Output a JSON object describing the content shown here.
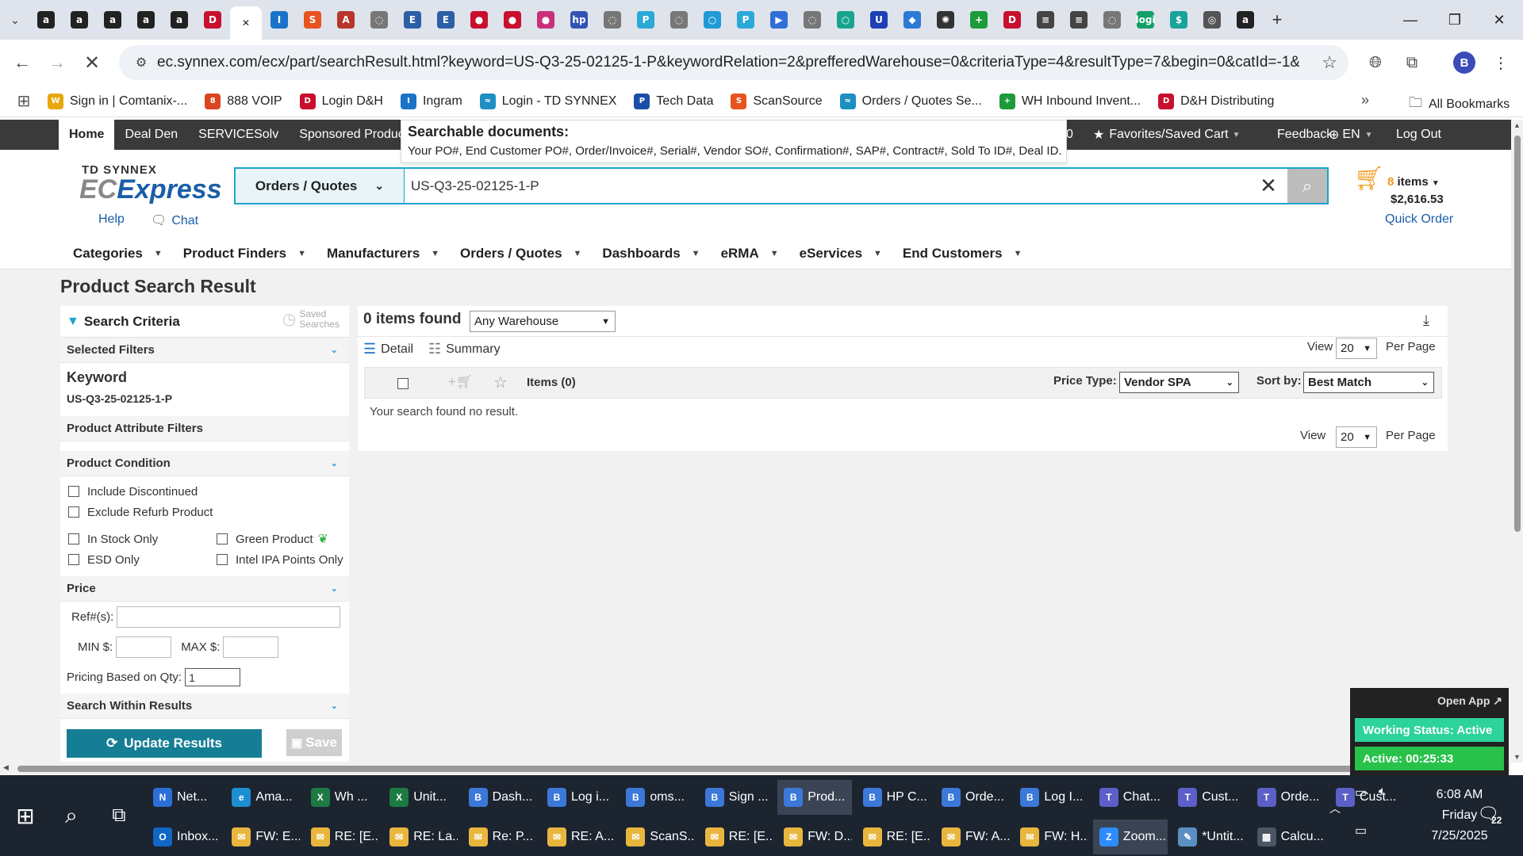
{
  "browser": {
    "tabs": [
      {
        "icon": "amazon-icon",
        "glyph": "a",
        "color": "#222222"
      },
      {
        "icon": "amazon-icon",
        "glyph": "a",
        "color": "#222222"
      },
      {
        "icon": "amazon-icon",
        "glyph": "a",
        "color": "#222222"
      },
      {
        "icon": "amazon-icon",
        "glyph": "a",
        "color": "#222222"
      },
      {
        "icon": "amazon-icon",
        "glyph": "a",
        "color": "#222222"
      },
      {
        "icon": "dh-icon",
        "glyph": "D",
        "color": "#c8102e"
      },
      {
        "icon": "td-synnex-icon",
        "glyph": "✕",
        "color": "#ffffff",
        "active": true
      },
      {
        "icon": "ingram-icon",
        "glyph": "I",
        "color": "#1a73c9"
      },
      {
        "icon": "scansource-icon",
        "glyph": "S",
        "color": "#e8541e"
      },
      {
        "icon": "site-icon",
        "glyph": "A",
        "color": "#b7352a"
      },
      {
        "icon": "globe-icon",
        "glyph": "◌",
        "color": "#777777"
      },
      {
        "icon": "site-icon",
        "glyph": "E",
        "color": "#2b5fa6"
      },
      {
        "icon": "site-icon",
        "glyph": "E",
        "color": "#2b5fa6"
      },
      {
        "icon": "site-icon",
        "glyph": "●",
        "color": "#c8102e"
      },
      {
        "icon": "site-icon",
        "glyph": "●",
        "color": "#c8102e"
      },
      {
        "icon": "site-icon",
        "glyph": "●",
        "color": "#c8317a"
      },
      {
        "icon": "hp-icon",
        "glyph": "hp",
        "color": "#3153b6"
      },
      {
        "icon": "globe-icon",
        "glyph": "◌",
        "color": "#777777"
      },
      {
        "icon": "site-icon",
        "glyph": "P",
        "color": "#2aa9d8"
      },
      {
        "icon": "globe-icon",
        "glyph": "◌",
        "color": "#777777"
      },
      {
        "icon": "site-icon",
        "glyph": "○",
        "color": "#1f9ad6"
      },
      {
        "icon": "site-icon",
        "glyph": "P",
        "color": "#2aa9d8"
      },
      {
        "icon": "site-icon",
        "glyph": "▶",
        "color": "#2f6fd6"
      },
      {
        "icon": "globe-icon",
        "glyph": "◌",
        "color": "#777777"
      },
      {
        "icon": "site-icon",
        "glyph": "○",
        "color": "#15a58d"
      },
      {
        "icon": "site-icon",
        "glyph": "U",
        "color": "#1f3fb5"
      },
      {
        "icon": "site-icon",
        "glyph": "◆",
        "color": "#2c7ad6"
      },
      {
        "icon": "openai-icon",
        "glyph": "✺",
        "color": "#333333"
      },
      {
        "icon": "site-icon",
        "glyph": "+",
        "color": "#1d9a3b"
      },
      {
        "icon": "dh-icon",
        "glyph": "D",
        "color": "#c8102e"
      },
      {
        "icon": "site-icon",
        "glyph": "≡",
        "color": "#444444"
      },
      {
        "icon": "site-icon",
        "glyph": "≡",
        "color": "#444444"
      },
      {
        "icon": "globe-icon",
        "glyph": "◌",
        "color": "#777777"
      },
      {
        "icon": "logi-icon",
        "glyph": "logi",
        "color": "#13a06a"
      },
      {
        "icon": "site-icon",
        "glyph": "$",
        "color": "#1aa39a"
      },
      {
        "icon": "site-icon",
        "glyph": "◎",
        "color": "#555555"
      },
      {
        "icon": "amazon-icon",
        "glyph": "a",
        "color": "#222222"
      }
    ],
    "url": "ec.synnex.com/ecx/part/searchResult.html?keyword=US-Q3-25-02125-1-P&keywordRelation=2&prefferedWarehouse=0&criteriaType=4&resultType=7&begin=0&catId=-1&suggestionS...",
    "profile_initial": "B",
    "bookmarks": [
      {
        "label": "Sign in | Comtanix-...",
        "icon": "comtanix-icon",
        "glyph": "W",
        "color": "#e8a80c"
      },
      {
        "label": "888 VOIP",
        "icon": "voip-icon",
        "glyph": "8",
        "color": "#d9461f"
      },
      {
        "label": "Login D&H",
        "icon": "dh-icon",
        "glyph": "D",
        "color": "#c8102e"
      },
      {
        "label": "Ingram",
        "icon": "ingram-icon",
        "glyph": "I",
        "color": "#1a73c9"
      },
      {
        "label": "Login - TD SYNNEX",
        "icon": "td-synnex-icon",
        "glyph": "≈",
        "color": "#1d8fc2"
      },
      {
        "label": "Tech Data",
        "icon": "tech-data-icon",
        "glyph": "P",
        "color": "#1a4fa8"
      },
      {
        "label": "ScanSource",
        "icon": "scansource-icon",
        "glyph": "S",
        "color": "#e8541e"
      },
      {
        "label": "Orders / Quotes Se...",
        "icon": "td-synnex-icon",
        "glyph": "≈",
        "color": "#1d8fc2"
      },
      {
        "label": "WH Inbound Invent...",
        "icon": "sheets-icon",
        "glyph": "+",
        "color": "#1d9a3b"
      },
      {
        "label": "D&H Distributing",
        "icon": "dh-icon",
        "glyph": "D",
        "color": "#c8102e"
      }
    ],
    "all_bookmarks": "All Bookmarks"
  },
  "sitebar": {
    "items": [
      "Home",
      "Deal Den",
      "SERVICESolv",
      "Sponsored Products"
    ],
    "hidden_fragment": "0",
    "favorites": "Favorites/Saved Cart",
    "feedback": "Feedback",
    "language": "EN",
    "logout": "Log Out"
  },
  "tooltip": {
    "title": "Searchable documents:",
    "body": "Your PO#, End Customer PO#, Order/Invoice#, Serial#, Vendor SO#, Confirmation#, SAP#, Contract#, Sold To ID#, Deal ID."
  },
  "header": {
    "brand_top": "TD SYNNEX",
    "brand_ec": "EC",
    "brand_express": "Express",
    "help": "Help",
    "chat": "Chat",
    "search_category": "Orders / Quotes",
    "search_value": "US-Q3-25-02125-1-P",
    "cart_count": "8",
    "cart_items_label": "items",
    "cart_total": "$2,616.53",
    "quick_order": "Quick Order"
  },
  "mainmenu": [
    "Categories",
    "Product Finders",
    "Manufacturers",
    "Orders / Quotes",
    "Dashboards",
    "eRMA",
    "eServices",
    "End Customers"
  ],
  "page": {
    "title": "Product Search Result"
  },
  "sidebar": {
    "title": "Search Criteria",
    "saved_searches_1": "Saved",
    "saved_searches_2": "Searches",
    "selected_filters": "Selected Filters",
    "keyword_label": "Keyword",
    "keyword_value": "US-Q3-25-02125-1-P",
    "attribute_filters": "Product Attribute Filters",
    "product_condition": "Product Condition",
    "include_discontinued": "Include Discontinued",
    "exclude_refurb": "Exclude Refurb Product",
    "in_stock_only": "In Stock Only",
    "green_product": "Green Product",
    "esd_only": "ESD Only",
    "intel_ipa": "Intel IPA Points Only",
    "price": "Price",
    "refs_label": "Ref#(s):",
    "min_label": "MIN $:",
    "max_label": "MAX $:",
    "pricing_qty_label": "Pricing Based on Qty:",
    "pricing_qty_value": "1",
    "search_within": "Search Within Results",
    "update_button": "Update Results",
    "save_button": "Save"
  },
  "results": {
    "found": "0 items found",
    "warehouse": "Any Warehouse",
    "detail": "Detail",
    "summary": "Summary",
    "view_label": "View",
    "view_value": "20",
    "per_page": "Per Page",
    "items_header": "Items (0)",
    "price_type_label": "Price Type:",
    "price_type_value": "Vendor SPA",
    "sort_label": "Sort by:",
    "sort_value": "Best Match",
    "no_result": "Your search found no result."
  },
  "status_widget": {
    "open_app": "Open App ↗",
    "working_status": "Working Status: Active",
    "active_time": "Active: 00:25:33"
  },
  "taskbar": {
    "row1": [
      {
        "label": "Net...",
        "icon": "network-icon",
        "color": "#2a6fd6",
        "glyph": "N"
      },
      {
        "label": "Ama...",
        "icon": "edge-icon",
        "color": "#1b8fd1",
        "glyph": "e"
      },
      {
        "label": "Wh ...",
        "icon": "excel-icon",
        "color": "#1d7a42",
        "glyph": "X"
      },
      {
        "label": "Unit...",
        "icon": "excel-icon",
        "color": "#1d7a42",
        "glyph": "X"
      },
      {
        "label": "Dash...",
        "icon": "chrome-icon",
        "color": "#3b78d8",
        "glyph": "B"
      },
      {
        "label": "Log i...",
        "icon": "chrome-icon",
        "color": "#3b78d8",
        "glyph": "B"
      },
      {
        "label": "oms...",
        "icon": "chrome-icon",
        "color": "#3b78d8",
        "glyph": "B"
      },
      {
        "label": "Sign ...",
        "icon": "chrome-icon",
        "color": "#3b78d8",
        "glyph": "B"
      },
      {
        "label": "Prod...",
        "icon": "chrome-icon",
        "color": "#3b78d8",
        "glyph": "B",
        "active": true
      },
      {
        "label": "HP C...",
        "icon": "chrome-icon",
        "color": "#3b78d8",
        "glyph": "B"
      },
      {
        "label": "Orde...",
        "icon": "chrome-icon",
        "color": "#3b78d8",
        "glyph": "B"
      },
      {
        "label": "Log I...",
        "icon": "chrome-icon",
        "color": "#3b78d8",
        "glyph": "B"
      },
      {
        "label": "Chat...",
        "icon": "teams-icon",
        "color": "#5b5fc7",
        "glyph": "T"
      },
      {
        "label": "Cust...",
        "icon": "teams-icon",
        "color": "#5b5fc7",
        "glyph": "T"
      },
      {
        "label": "Orde...",
        "icon": "teams-icon",
        "color": "#5b5fc7",
        "glyph": "T"
      },
      {
        "label": "Cust...",
        "icon": "teams-icon",
        "color": "#5b5fc7",
        "glyph": "T"
      }
    ],
    "row2": [
      {
        "label": "Inbox...",
        "icon": "outlook-icon",
        "color": "#1266c4",
        "glyph": "O"
      },
      {
        "label": "FW: E...",
        "icon": "mail-icon",
        "color": "#e8b63e",
        "glyph": "✉"
      },
      {
        "label": "RE: [E...",
        "icon": "mail-icon",
        "color": "#e8b63e",
        "glyph": "✉"
      },
      {
        "label": "RE: La...",
        "icon": "mail-icon",
        "color": "#e8b63e",
        "glyph": "✉"
      },
      {
        "label": "Re: P...",
        "icon": "mail-icon",
        "color": "#e8b63e",
        "glyph": "✉"
      },
      {
        "label": "RE: A...",
        "icon": "mail-icon",
        "color": "#e8b63e",
        "glyph": "✉"
      },
      {
        "label": "ScanS...",
        "icon": "mail-icon",
        "color": "#e8b63e",
        "glyph": "✉"
      },
      {
        "label": "RE: [E...",
        "icon": "mail-icon",
        "color": "#e8b63e",
        "glyph": "✉"
      },
      {
        "label": "FW: D...",
        "icon": "mail-icon",
        "color": "#e8b63e",
        "glyph": "✉"
      },
      {
        "label": "RE: [E...",
        "icon": "mail-icon",
        "color": "#e8b63e",
        "glyph": "✉"
      },
      {
        "label": "FW: A...",
        "icon": "mail-icon",
        "color": "#e8b63e",
        "glyph": "✉"
      },
      {
        "label": "FW: H...",
        "icon": "mail-icon",
        "color": "#e8b63e",
        "glyph": "✉"
      },
      {
        "label": "Zoom...",
        "icon": "zoom-icon",
        "color": "#2d8cff",
        "glyph": "Z",
        "active": true
      },
      {
        "label": "*Untit...",
        "icon": "notepad-icon",
        "color": "#5a8fc2",
        "glyph": "✎"
      },
      {
        "label": "Calcu...",
        "icon": "calculator-icon",
        "color": "#4b5563",
        "glyph": "▦"
      }
    ],
    "time": "6:08 AM",
    "day": "Friday",
    "date": "7/25/2025",
    "notification_count": "22"
  }
}
